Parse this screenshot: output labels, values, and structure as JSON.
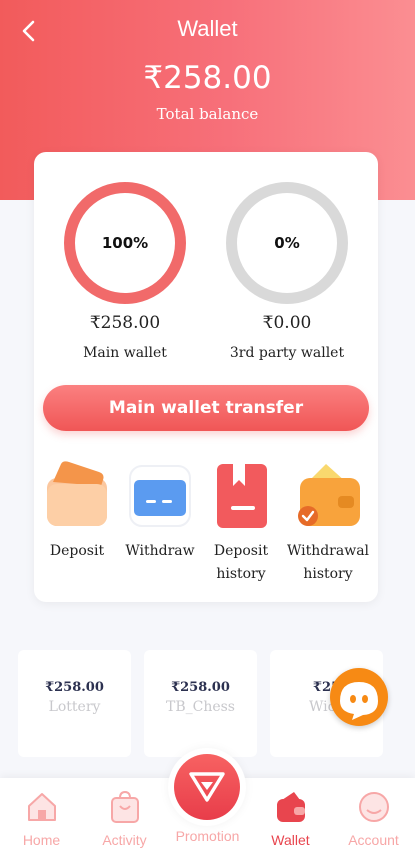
{
  "header": {
    "title": "Wallet",
    "balance": "₹258.00",
    "balance_label": "Total balance"
  },
  "wallets": {
    "main": {
      "percent_text": "100%",
      "percent": 1.0,
      "amount": "₹258.00",
      "label": "Main wallet"
    },
    "third_party": {
      "percent_text": "0%",
      "percent": 0.0,
      "amount": "₹0.00",
      "label": "3rd party wallet"
    }
  },
  "transfer_button": "Main wallet transfer",
  "actions": [
    {
      "label_line1": "Deposit",
      "label_line2": "",
      "icon": "deposit-icon"
    },
    {
      "label_line1": "Withdraw",
      "label_line2": "",
      "icon": "withdraw-icon"
    },
    {
      "label_line1": "Deposit",
      "label_line2": "history",
      "icon": "deposit-history-icon"
    },
    {
      "label_line1": "Withdrawal",
      "label_line2": "history",
      "icon": "withdrawal-history-icon"
    }
  ],
  "games": [
    {
      "amount": "₹258.00",
      "name": "Lottery"
    },
    {
      "amount": "₹258.00",
      "name": "TB_Chess"
    },
    {
      "amount": "₹25",
      "name": "Wick"
    }
  ],
  "tabs": [
    {
      "label": "Home",
      "icon": "home-icon"
    },
    {
      "label": "Activity",
      "icon": "activity-icon"
    },
    {
      "label": "Promotion",
      "icon": "diamond-icon"
    },
    {
      "label": "Wallet",
      "icon": "wallet-icon"
    },
    {
      "label": "Account",
      "icon": "account-icon"
    }
  ],
  "colors": {
    "accent": "#f05656",
    "active_tab": "#e8454e",
    "inactive_tab": "#f7a7a7",
    "ring_main": "#f16a6a",
    "ring_empty": "#d9d9d9"
  }
}
